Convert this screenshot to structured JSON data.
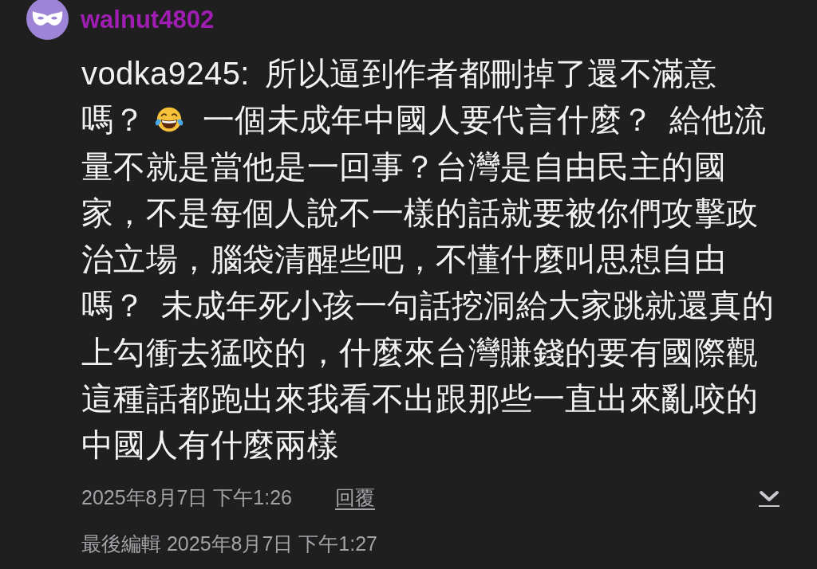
{
  "author": {
    "username": "walnut4802"
  },
  "comment": {
    "blocks": [
      {
        "segments": [
          {
            "kind": "text",
            "text": "vodka9245: 所以逼到作者都刪掉了還不滿意"
          }
        ]
      },
      {
        "segments": [
          {
            "kind": "text",
            "text": "嗎？"
          },
          {
            "kind": "emoji"
          },
          {
            "kind": "text",
            "text": "一個未成年中國人要代言什麼？ 給他流"
          }
        ]
      },
      {
        "segments": [
          {
            "kind": "text",
            "text": "量不就是當他是一回事？台灣是自由民主的國家，不是每個人說不一樣的話就要被你們攻擊政治立場，腦袋清醒些吧，不懂什麼叫思想自由嗎？ 未成年死小孩一句話挖洞給大家跳就還真的上勾衝去猛咬的，什麼來台灣賺錢的要有國際觀這種話都跑出來我看不出跟那些一直出來亂咬的中國人有什麼兩樣"
          }
        ]
      }
    ]
  },
  "meta": {
    "timestamp": "2025年8月7日 下午1:26",
    "reply_link": "回覆",
    "edited": "最後編輯 2025年8月7日 下午1:27"
  }
}
